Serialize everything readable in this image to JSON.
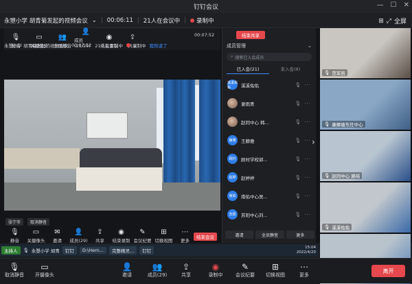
{
  "window": {
    "title": "钉钉会议",
    "fullscreen_label": "全屏"
  },
  "meeting": {
    "name": "永曌小学 胡青菊发起的视频会议",
    "timer": "00:06:11",
    "attendance": "21人在会议中",
    "recording": "录制中"
  },
  "inner": {
    "toolbar": [
      {
        "icon": "mic-icon",
        "glyph": "🎙",
        "label": "静音"
      },
      {
        "icon": "camera-icon",
        "glyph": "▭",
        "label": "关摄像头"
      },
      {
        "icon": "mute-all-icon",
        "glyph": "👥",
        "label": "全员静音"
      },
      {
        "icon": "members-icon",
        "glyph": "👤",
        "label": "成员(21/29)"
      },
      {
        "icon": "stop-record-icon",
        "glyph": "◉",
        "label": "结束录制"
      },
      {
        "icon": "share-icon",
        "glyph": "⇪",
        "label": "共享"
      }
    ],
    "time": "00:07:52",
    "meeting_name": "永曌小学 胡青菊发起的视频会议",
    "timer": "00:07:52",
    "attendance": "21人在会议中",
    "recording": "录制中",
    "hint": "我知道了",
    "video_labels": [
      "张宁市",
      "取消静音"
    ],
    "bottom_toolbar": [
      {
        "icon": "mic-icon",
        "glyph": "🎙",
        "label": "静音"
      },
      {
        "icon": "camera-icon",
        "glyph": "▭",
        "label": "关摄像头"
      },
      {
        "icon": "invite-icon",
        "glyph": "✉",
        "label": "邀请"
      },
      {
        "icon": "members-icon",
        "glyph": "👤",
        "label": "成员(29)"
      },
      {
        "icon": "share-icon",
        "glyph": "⇪",
        "label": "共享"
      },
      {
        "icon": "stop-record-icon",
        "glyph": "◉",
        "label": "结束录制"
      },
      {
        "icon": "notes-icon",
        "glyph": "✎",
        "label": "会议纪要"
      },
      {
        "icon": "layout-icon",
        "glyph": "⊞",
        "label": "切换视图"
      },
      {
        "icon": "more-icon",
        "glyph": "⋯",
        "label": "更多"
      }
    ],
    "end_label": "结束会议"
  },
  "panel": {
    "share_label": "结束共享",
    "title": "成员管理",
    "search_placeholder": "搜索已入会成员",
    "tabs": [
      "已入会(21)",
      "未入会(8)"
    ],
    "members": [
      {
        "avatar": "溪溪佑佑",
        "name": "溪溪佑佑",
        "photo": false
      },
      {
        "avatar": "",
        "name": "谢雨青",
        "photo": true
      },
      {
        "avatar": "",
        "name": "赵同中心 韩...",
        "photo": true
      },
      {
        "avatar": "静雅",
        "name": "王静雅",
        "photo": false
      },
      {
        "avatar": "顾村",
        "name": "顾村学校郭...",
        "photo": false
      },
      {
        "avatar": "赵婷",
        "name": "赵婷婷",
        "photo": false
      },
      {
        "avatar": "南佑",
        "name": "南佑中心吴...",
        "photo": false
      },
      {
        "avatar": "苏阳",
        "name": "苏阳中心刘...",
        "photo": false
      }
    ],
    "footer": [
      "邀请",
      "全员静音",
      "更多"
    ]
  },
  "thumbnails": [
    {
      "label": "范军凯",
      "colors": [
        "#c9c6c1",
        "#5a4e46"
      ]
    },
    {
      "label": "康卿塘东社中心",
      "colors": [
        "#8aa8c6",
        "#3f5f86"
      ]
    },
    {
      "label": "赵同中心 路瑶",
      "colors": [
        "#b8c5d1",
        "#2a4f89"
      ]
    },
    {
      "label": "溪溪佑佑",
      "colors": [
        "#c1c7cd",
        "#3b6aa8"
      ]
    },
    {
      "label": "",
      "colors": [
        "#b9c3cc",
        "#4c7db8"
      ]
    }
  ],
  "taskbar": {
    "host": "主持人",
    "school": "永曌小学 胡青",
    "chips": [
      "钉钉",
      "D:\\Hern...",
      "完整精灵...",
      "钉钉"
    ],
    "clock_time": "15:04",
    "clock_date": "2022/4/20"
  },
  "bottombar": {
    "items": [
      {
        "icon": "unmute-icon",
        "glyph": "🎙",
        "label": "取消静音"
      },
      {
        "icon": "camera-on-icon",
        "glyph": "▭",
        "label": "开摄像头"
      },
      {
        "icon": "invite-icon",
        "glyph": "👤",
        "label": "邀请"
      },
      {
        "icon": "members-icon",
        "glyph": "👥",
        "label": "成员(29)"
      },
      {
        "icon": "share-icon",
        "glyph": "⇪",
        "label": "共享"
      },
      {
        "icon": "record-icon",
        "glyph": "◉",
        "label": "录制中"
      },
      {
        "icon": "notes-icon",
        "glyph": "✎",
        "label": "会议纪要"
      },
      {
        "icon": "layout-icon",
        "glyph": "⊞",
        "label": "切换视图"
      },
      {
        "icon": "more-icon",
        "glyph": "⋯",
        "label": "更多"
      }
    ],
    "leave_label": "离开"
  }
}
